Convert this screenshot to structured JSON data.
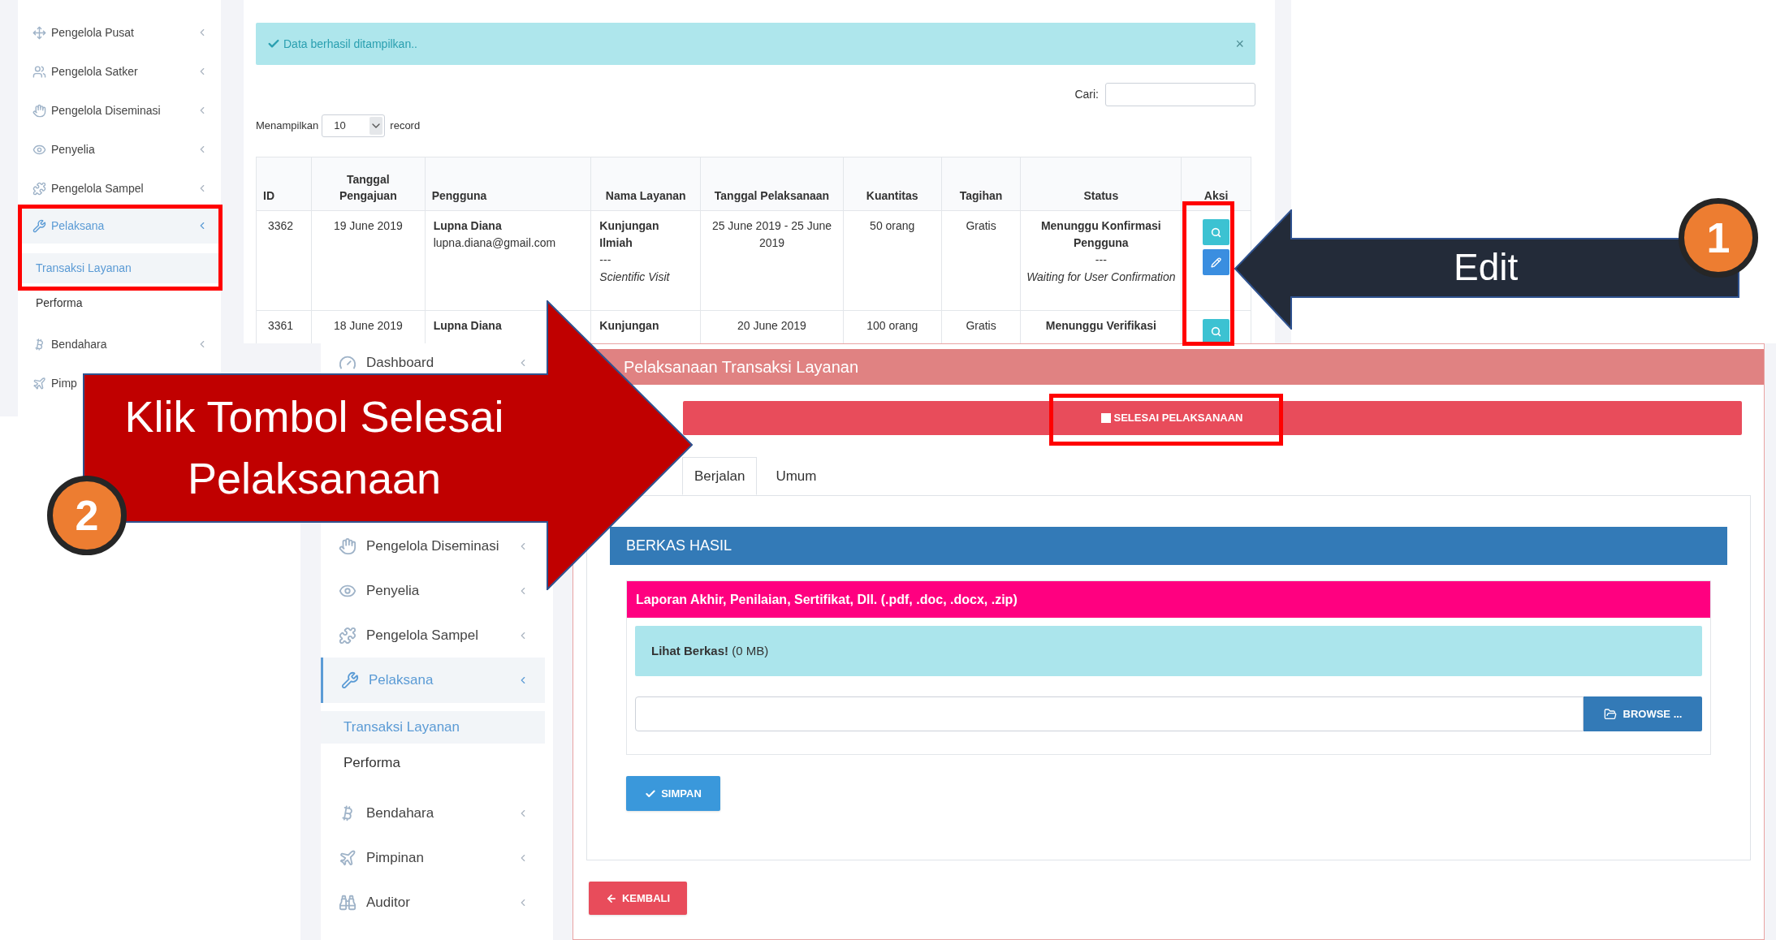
{
  "list_view": {
    "sidebar": {
      "items": [
        {
          "label": "Pengelola Pusat",
          "selected": false
        },
        {
          "label": "Pengelola Satker",
          "selected": false
        },
        {
          "label": "Pengelola Diseminasi",
          "selected": false
        },
        {
          "label": "Penyelia",
          "selected": false
        },
        {
          "label": "Pengelola Sampel",
          "selected": false
        },
        {
          "label": "Pelaksana",
          "selected": true,
          "children": [
            {
              "label": "Transaksi Layanan",
              "selected": true
            },
            {
              "label": "Performa",
              "selected": false
            }
          ]
        },
        {
          "label": "Bendahara",
          "selected": false
        },
        {
          "label": "Pimp",
          "selected": false
        }
      ]
    },
    "alert": {
      "text": "Data berhasil ditampilkan..",
      "close": "×"
    },
    "search": {
      "label": "Cari:"
    },
    "length": {
      "label": "Menampilkan",
      "value": "10",
      "suffix": "record"
    },
    "table": {
      "columns": [
        "ID",
        "Tanggal Pengajuan",
        "Pengguna",
        "Nama Layanan",
        "Tanggal Pelaksanaan",
        "Kuantitas",
        "Tagihan",
        "Status",
        "Aksi"
      ],
      "rows": [
        {
          "id": "3362",
          "submitted": "19 June 2019",
          "user": {
            "name": "Lupna Diana",
            "email": "lupna.diana@gmail.com"
          },
          "service": {
            "name": "Kunjungan Ilmiah",
            "divider": "---",
            "english": "Scientific Visit"
          },
          "schedule": "25 June 2019 - 25 June 2019",
          "quantity": "50 orang",
          "bill": "Gratis",
          "status": {
            "title": "Menunggu Konfirmasi Pengguna",
            "divider": "---",
            "english": "Waiting for User Confirmation"
          },
          "actions": [
            {
              "kind": "view"
            },
            {
              "kind": "edit"
            }
          ]
        },
        {
          "id": "3361",
          "submitted": "18 June 2019",
          "user": {
            "name": "Lupna Diana"
          },
          "service": {
            "name": "Kunjungan"
          },
          "schedule": "20 June 2019",
          "quantity": "100 orang",
          "bill": "Gratis",
          "status": {
            "title": "Menunggu Verifikasi"
          },
          "actions": [
            {
              "kind": "view"
            }
          ]
        }
      ]
    }
  },
  "detail_view": {
    "sidebar": {
      "items": [
        {
          "label": "Dashboard",
          "selected": false
        },
        {
          "label": "Pengelola Diseminasi",
          "selected": false
        },
        {
          "label": "Penyelia",
          "selected": false
        },
        {
          "label": "Pengelola Sampel",
          "selected": false
        },
        {
          "label": "Pelaksana",
          "selected": true,
          "children": [
            {
              "label": "Transaksi Layanan",
              "selected": true
            },
            {
              "label": "Performa",
              "selected": false
            }
          ]
        },
        {
          "label": "Bendahara",
          "selected": false
        },
        {
          "label": "Pimpinan",
          "selected": false
        },
        {
          "label": "Auditor",
          "selected": false
        }
      ]
    },
    "panel": {
      "title": "Pelaksanaan Transaksi Layanan",
      "finish_button": "SELESAI PELAKSANAAN",
      "tabs": [
        {
          "label": "Berjalan",
          "selected": true
        },
        {
          "label": "Umum",
          "selected": false
        }
      ],
      "section_title": "BERKAS HASIL",
      "file_card": {
        "title": "Laporan Akhir, Penilaian, Sertifikat, Dll. (.pdf, .doc, .docx, .zip)",
        "alert": "**Lihat Berkas!** (0 MB)",
        "browse_button": "BROWSE ..."
      },
      "save_button": "SIMPAN",
      "back_button": "KEMBALI"
    }
  },
  "annotations": {
    "edit_callout": {
      "number": "1",
      "text": "Edit"
    },
    "finish_callout": {
      "number": "2",
      "text": "Klik Tombol Selesai Pelaksanaan"
    }
  }
}
